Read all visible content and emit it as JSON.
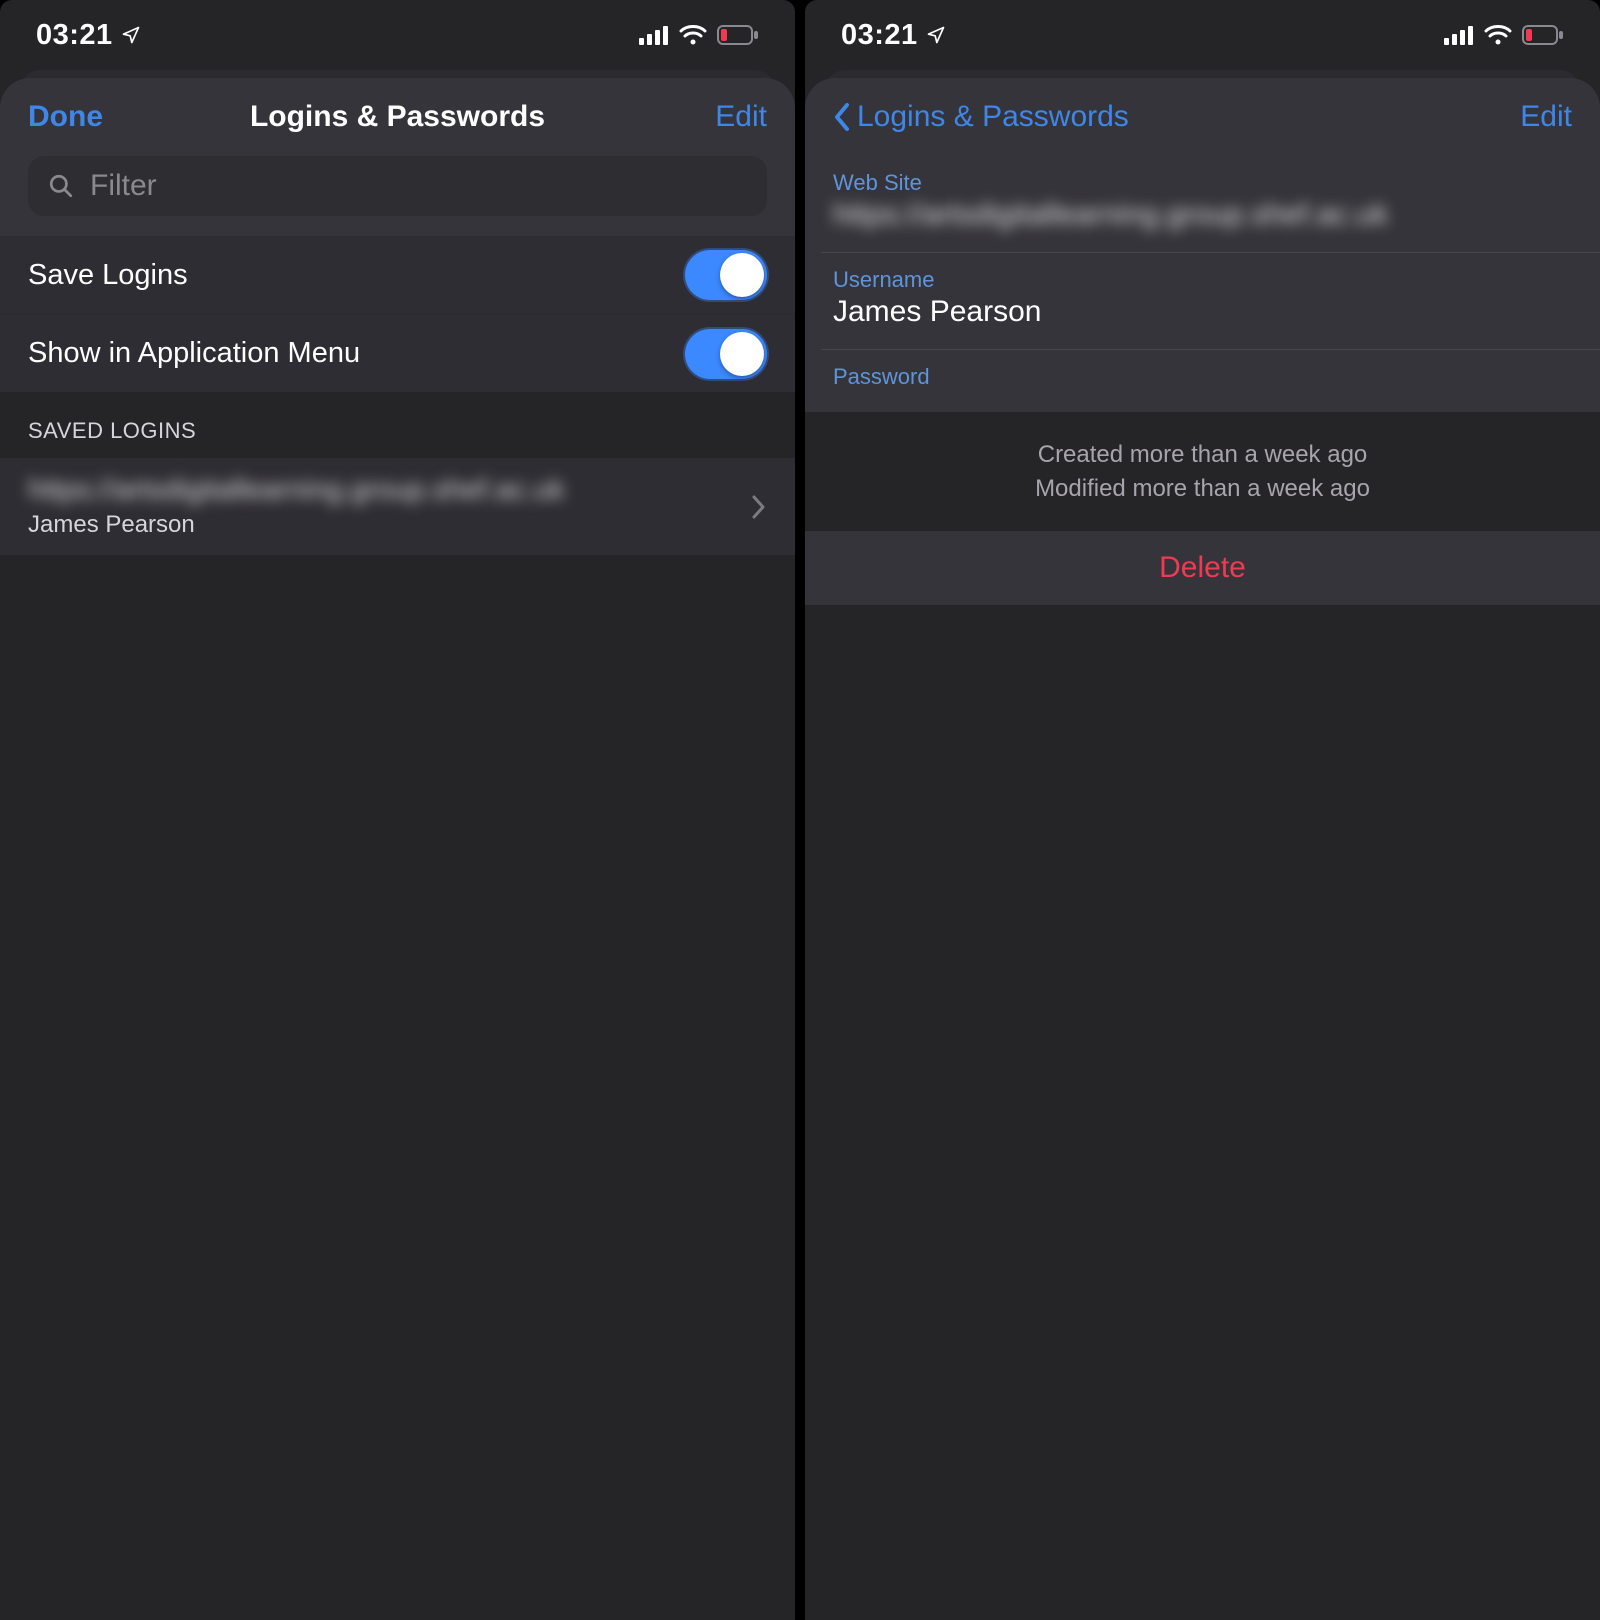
{
  "status": {
    "time": "03:21"
  },
  "left": {
    "nav": {
      "done": "Done",
      "title": "Logins & Passwords",
      "edit": "Edit"
    },
    "search": {
      "placeholder": "Filter"
    },
    "toggles": {
      "save_logins": "Save Logins",
      "show_in_menu": "Show in Application Menu"
    },
    "section_header": "SAVED LOGINS",
    "saved": {
      "site": "https://artsdigitallearning.group.shef.ac.uk",
      "user": "James Pearson"
    }
  },
  "right": {
    "nav": {
      "back": "Logins & Passwords",
      "edit": "Edit"
    },
    "fields": {
      "website_label": "Web Site",
      "website_value": "https://artsdigitallearning.group.shef.ac.uk",
      "username_label": "Username",
      "username_value": "James Pearson",
      "password_label": "Password"
    },
    "meta": {
      "created": "Created more than a week ago",
      "modified": "Modified more than a week ago"
    },
    "delete": "Delete"
  }
}
